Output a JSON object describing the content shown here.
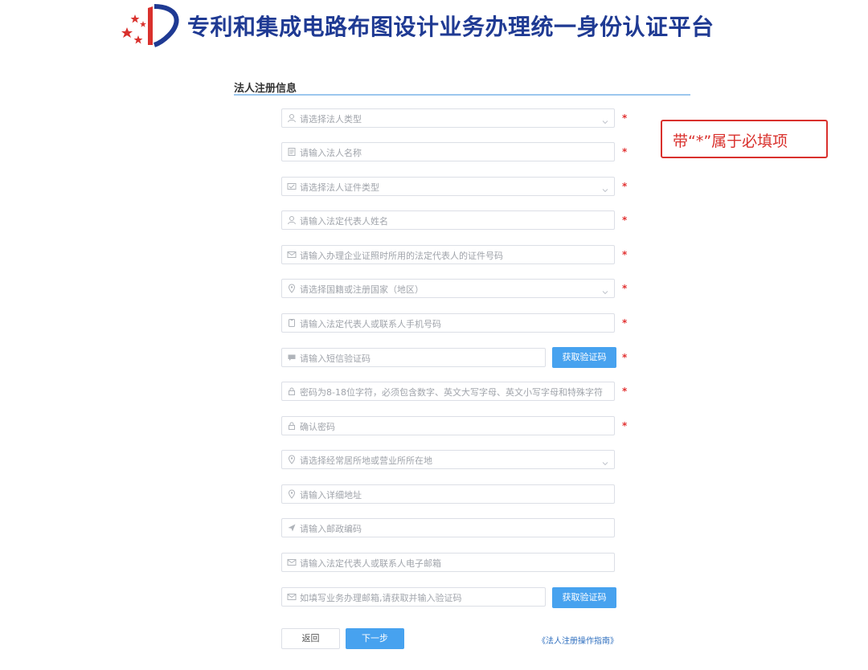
{
  "header": {
    "title": "专利和集成电路布图设计业务办理统一身份认证平台"
  },
  "section": {
    "title": "法人注册信息"
  },
  "form": {
    "fields": [
      {
        "placeholder": "请选择法人类型",
        "icon": "user-icon",
        "dropdown": true,
        "required": true
      },
      {
        "placeholder": "请输入法人名称",
        "icon": "document-icon",
        "dropdown": false,
        "required": true
      },
      {
        "placeholder": "请选择法人证件类型",
        "icon": "id-card-icon",
        "dropdown": true,
        "required": true
      },
      {
        "placeholder": "请输入法定代表人姓名",
        "icon": "user-icon",
        "dropdown": false,
        "required": true
      },
      {
        "placeholder": "请输入办理企业证照时所用的法定代表人的证件号码",
        "icon": "id-card-icon",
        "dropdown": false,
        "required": true
      },
      {
        "placeholder": "请选择国籍或注册国家（地区）",
        "icon": "location-icon",
        "dropdown": true,
        "required": true
      },
      {
        "placeholder": "请输入法定代表人或联系人手机号码",
        "icon": "phone-icon",
        "dropdown": false,
        "required": true
      },
      {
        "placeholder": "请输入短信验证码",
        "icon": "message-icon",
        "dropdown": false,
        "required": true
      },
      {
        "placeholder": "密码为8-18位字符，必须包含数字、英文大写字母、英文小写字母和特殊字符",
        "icon": "lock-icon",
        "dropdown": false,
        "required": true
      },
      {
        "placeholder": "确认密码",
        "icon": "lock-icon",
        "dropdown": false,
        "required": true
      },
      {
        "placeholder": "请选择经常居所地或营业所所在地",
        "icon": "location-icon",
        "dropdown": true,
        "required": false
      },
      {
        "placeholder": "请输入详细地址",
        "icon": "location-icon",
        "dropdown": false,
        "required": false
      },
      {
        "placeholder": "请输入邮政编码",
        "icon": "send-icon",
        "dropdown": false,
        "required": false
      },
      {
        "placeholder": "请输入法定代表人或联系人电子邮箱",
        "icon": "mail-icon",
        "dropdown": false,
        "required": false
      },
      {
        "placeholder": "如填写业务办理邮箱,请获取并输入验证码",
        "icon": "mail-icon",
        "dropdown": false,
        "required": false
      }
    ],
    "required_mark": "*",
    "sms_code_button": "获取验证码",
    "email_code_button": "获取验证码",
    "back_button": "返回",
    "next_button": "下一步",
    "guide_link": "《法人注册操作指南》"
  },
  "callout": {
    "text": "带“*”属于必填项"
  },
  "colors": {
    "title_blue": "#1f3a93",
    "button_blue": "#47a2ef",
    "required_red": "#e23232",
    "callout_red": "#d9312d",
    "section_line": "#9cc7ee"
  }
}
